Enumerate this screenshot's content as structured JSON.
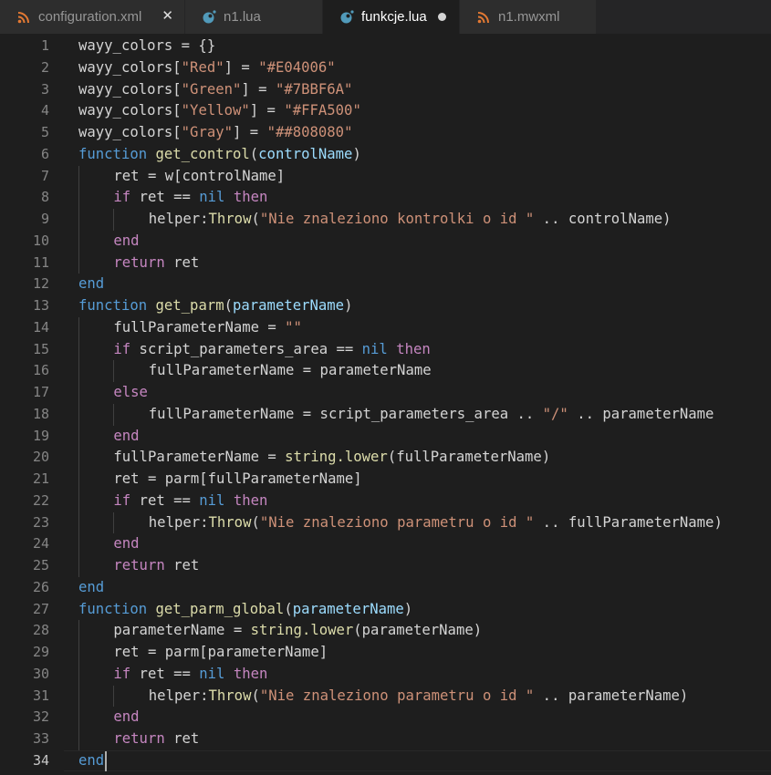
{
  "tabs": [
    {
      "label": "configuration.xml",
      "icon": "rss-file-icon",
      "action": "close",
      "active": false
    },
    {
      "label": "n1.lua",
      "icon": "lua-file-icon",
      "action": "none",
      "active": false
    },
    {
      "label": "funkcje.lua",
      "icon": "lua-file-icon",
      "action": "modified",
      "active": true
    },
    {
      "label": "n1.mwxml",
      "icon": "rss-file-icon",
      "action": "none",
      "active": false
    }
  ],
  "colors": {
    "keyword": "#569cd6",
    "control": "#c586c0",
    "function": "#dcdcaa",
    "string": "#ce9178",
    "parameter": "#9cdcfe",
    "text": "#d4d4d4",
    "line_number": "#858585",
    "editor_bg": "#1e1e1e",
    "tab_bg": "#2d2d2d",
    "rss_icon": "#e37933",
    "lua_icon": "#519aba"
  },
  "editor": {
    "current_line": 34,
    "lines": [
      {
        "n": "1",
        "indent": 0,
        "tokens": [
          {
            "t": "wayy_colors = {}",
            "c": "plain"
          }
        ]
      },
      {
        "n": "2",
        "indent": 0,
        "tokens": [
          {
            "t": "wayy_colors[",
            "c": "plain"
          },
          {
            "t": "\"Red\"",
            "c": "str"
          },
          {
            "t": "] = ",
            "c": "plain"
          },
          {
            "t": "\"#E04006\"",
            "c": "str"
          }
        ]
      },
      {
        "n": "3",
        "indent": 0,
        "tokens": [
          {
            "t": "wayy_colors[",
            "c": "plain"
          },
          {
            "t": "\"Green\"",
            "c": "str"
          },
          {
            "t": "] = ",
            "c": "plain"
          },
          {
            "t": "\"#7BBF6A\"",
            "c": "str"
          }
        ]
      },
      {
        "n": "4",
        "indent": 0,
        "tokens": [
          {
            "t": "wayy_colors[",
            "c": "plain"
          },
          {
            "t": "\"Yellow\"",
            "c": "str"
          },
          {
            "t": "] = ",
            "c": "plain"
          },
          {
            "t": "\"#FFA500\"",
            "c": "str"
          }
        ]
      },
      {
        "n": "5",
        "indent": 0,
        "tokens": [
          {
            "t": "wayy_colors[",
            "c": "plain"
          },
          {
            "t": "\"Gray\"",
            "c": "str"
          },
          {
            "t": "] = ",
            "c": "plain"
          },
          {
            "t": "\"##808080\"",
            "c": "str"
          }
        ]
      },
      {
        "n": "6",
        "indent": 0,
        "tokens": [
          {
            "t": "function",
            "c": "kw"
          },
          {
            "t": " ",
            "c": "plain"
          },
          {
            "t": "get_control",
            "c": "fn"
          },
          {
            "t": "(",
            "c": "plain"
          },
          {
            "t": "controlName",
            "c": "param"
          },
          {
            "t": ")",
            "c": "plain"
          }
        ]
      },
      {
        "n": "7",
        "indent": 1,
        "tokens": [
          {
            "t": "ret = w[controlName]",
            "c": "plain"
          }
        ]
      },
      {
        "n": "8",
        "indent": 1,
        "tokens": [
          {
            "t": "if",
            "c": "ctl"
          },
          {
            "t": " ret == ",
            "c": "plain"
          },
          {
            "t": "nil",
            "c": "kw"
          },
          {
            "t": " ",
            "c": "plain"
          },
          {
            "t": "then",
            "c": "ctl"
          }
        ]
      },
      {
        "n": "9",
        "indent": 2,
        "tokens": [
          {
            "t": "helper:",
            "c": "plain"
          },
          {
            "t": "Throw",
            "c": "fn"
          },
          {
            "t": "(",
            "c": "plain"
          },
          {
            "t": "\"Nie znaleziono kontrolki o id \"",
            "c": "str"
          },
          {
            "t": " .. controlName)",
            "c": "plain"
          }
        ]
      },
      {
        "n": "10",
        "indent": 1,
        "tokens": [
          {
            "t": "end",
            "c": "ctl"
          }
        ]
      },
      {
        "n": "11",
        "indent": 1,
        "tokens": [
          {
            "t": "return",
            "c": "ctl"
          },
          {
            "t": " ret",
            "c": "plain"
          }
        ]
      },
      {
        "n": "12",
        "indent": 0,
        "tokens": [
          {
            "t": "end",
            "c": "kw"
          }
        ]
      },
      {
        "n": "13",
        "indent": 0,
        "tokens": [
          {
            "t": "function",
            "c": "kw"
          },
          {
            "t": " ",
            "c": "plain"
          },
          {
            "t": "get_parm",
            "c": "fn"
          },
          {
            "t": "(",
            "c": "plain"
          },
          {
            "t": "parameterName",
            "c": "param"
          },
          {
            "t": ")",
            "c": "plain"
          }
        ]
      },
      {
        "n": "14",
        "indent": 1,
        "tokens": [
          {
            "t": "fullParameterName = ",
            "c": "plain"
          },
          {
            "t": "\"\"",
            "c": "str"
          }
        ]
      },
      {
        "n": "15",
        "indent": 1,
        "tokens": [
          {
            "t": "if",
            "c": "ctl"
          },
          {
            "t": " script_parameters_area == ",
            "c": "plain"
          },
          {
            "t": "nil",
            "c": "kw"
          },
          {
            "t": " ",
            "c": "plain"
          },
          {
            "t": "then",
            "c": "ctl"
          }
        ]
      },
      {
        "n": "16",
        "indent": 2,
        "tokens": [
          {
            "t": "fullParameterName = parameterName",
            "c": "plain"
          }
        ]
      },
      {
        "n": "17",
        "indent": 1,
        "tokens": [
          {
            "t": "else",
            "c": "ctl"
          }
        ]
      },
      {
        "n": "18",
        "indent": 2,
        "tokens": [
          {
            "t": "fullParameterName = script_parameters_area .. ",
            "c": "plain"
          },
          {
            "t": "\"/\"",
            "c": "str"
          },
          {
            "t": " .. parameterName",
            "c": "plain"
          }
        ]
      },
      {
        "n": "19",
        "indent": 1,
        "tokens": [
          {
            "t": "end",
            "c": "ctl"
          }
        ]
      },
      {
        "n": "20",
        "indent": 1,
        "tokens": [
          {
            "t": "fullParameterName = ",
            "c": "plain"
          },
          {
            "t": "string.lower",
            "c": "fn"
          },
          {
            "t": "(fullParameterName)",
            "c": "plain"
          }
        ]
      },
      {
        "n": "21",
        "indent": 1,
        "tokens": [
          {
            "t": "ret = parm[fullParameterName]",
            "c": "plain"
          }
        ]
      },
      {
        "n": "22",
        "indent": 1,
        "tokens": [
          {
            "t": "if",
            "c": "ctl"
          },
          {
            "t": " ret == ",
            "c": "plain"
          },
          {
            "t": "nil",
            "c": "kw"
          },
          {
            "t": " ",
            "c": "plain"
          },
          {
            "t": "then",
            "c": "ctl"
          }
        ]
      },
      {
        "n": "23",
        "indent": 2,
        "tokens": [
          {
            "t": "helper:",
            "c": "plain"
          },
          {
            "t": "Throw",
            "c": "fn"
          },
          {
            "t": "(",
            "c": "plain"
          },
          {
            "t": "\"Nie znaleziono parametru o id \"",
            "c": "str"
          },
          {
            "t": " .. fullParameterName)",
            "c": "plain"
          }
        ]
      },
      {
        "n": "24",
        "indent": 1,
        "tokens": [
          {
            "t": "end",
            "c": "ctl"
          }
        ]
      },
      {
        "n": "25",
        "indent": 1,
        "tokens": [
          {
            "t": "return",
            "c": "ctl"
          },
          {
            "t": " ret",
            "c": "plain"
          }
        ]
      },
      {
        "n": "26",
        "indent": 0,
        "tokens": [
          {
            "t": "end",
            "c": "kw"
          }
        ]
      },
      {
        "n": "27",
        "indent": 0,
        "tokens": [
          {
            "t": "function",
            "c": "kw"
          },
          {
            "t": " ",
            "c": "plain"
          },
          {
            "t": "get_parm_global",
            "c": "fn"
          },
          {
            "t": "(",
            "c": "plain"
          },
          {
            "t": "parameterName",
            "c": "param"
          },
          {
            "t": ")",
            "c": "plain"
          }
        ]
      },
      {
        "n": "28",
        "indent": 1,
        "tokens": [
          {
            "t": "parameterName = ",
            "c": "plain"
          },
          {
            "t": "string.lower",
            "c": "fn"
          },
          {
            "t": "(parameterName)",
            "c": "plain"
          }
        ]
      },
      {
        "n": "29",
        "indent": 1,
        "tokens": [
          {
            "t": "ret = parm[parameterName]",
            "c": "plain"
          }
        ]
      },
      {
        "n": "30",
        "indent": 1,
        "tokens": [
          {
            "t": "if",
            "c": "ctl"
          },
          {
            "t": " ret == ",
            "c": "plain"
          },
          {
            "t": "nil",
            "c": "kw"
          },
          {
            "t": " ",
            "c": "plain"
          },
          {
            "t": "then",
            "c": "ctl"
          }
        ]
      },
      {
        "n": "31",
        "indent": 2,
        "tokens": [
          {
            "t": "helper:",
            "c": "plain"
          },
          {
            "t": "Throw",
            "c": "fn"
          },
          {
            "t": "(",
            "c": "plain"
          },
          {
            "t": "\"Nie znaleziono parametru o id \"",
            "c": "str"
          },
          {
            "t": " .. parameterName)",
            "c": "plain"
          }
        ]
      },
      {
        "n": "32",
        "indent": 1,
        "tokens": [
          {
            "t": "end",
            "c": "ctl"
          }
        ]
      },
      {
        "n": "33",
        "indent": 1,
        "tokens": [
          {
            "t": "return",
            "c": "ctl"
          },
          {
            "t": " ret",
            "c": "plain"
          }
        ]
      },
      {
        "n": "34",
        "indent": 0,
        "tokens": [
          {
            "t": "end",
            "c": "kw"
          }
        ]
      }
    ]
  }
}
